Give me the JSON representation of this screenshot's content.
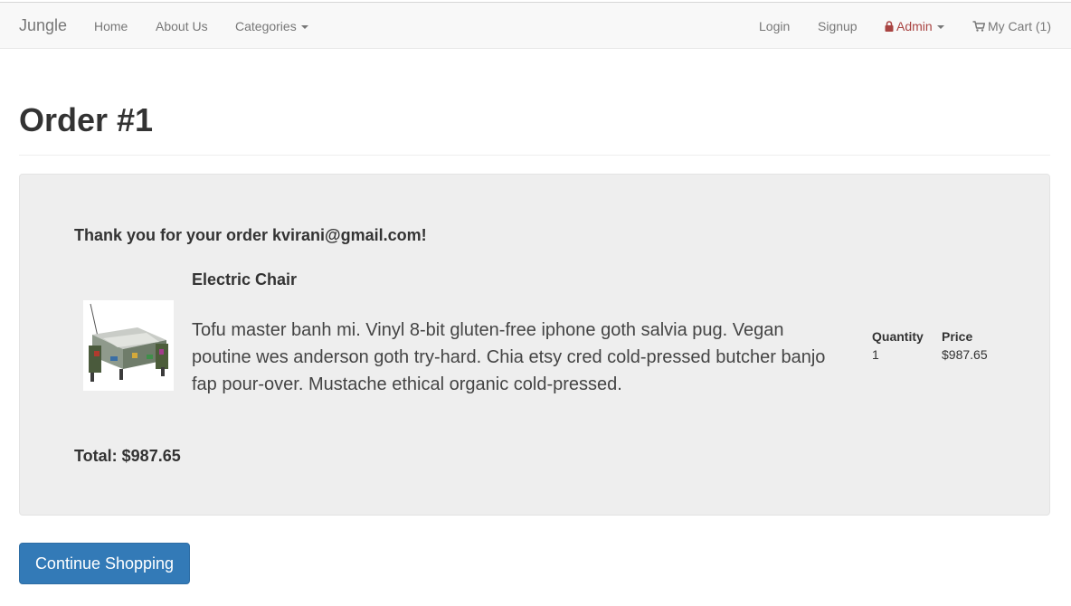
{
  "navbar": {
    "brand": "Jungle",
    "left_links": [
      "Home",
      "About Us",
      "Categories"
    ],
    "right_links": {
      "login": "Login",
      "signup": "Signup",
      "admin": "Admin",
      "cart": "My Cart (1)"
    },
    "admin_color": "#a94442"
  },
  "page": {
    "title": "Order #1"
  },
  "order": {
    "thank_you": "Thank you for your order kvirani@gmail.com!",
    "item": {
      "name": "Electric Chair",
      "description": "Tofu master banh mi. Vinyl 8-bit gluten-free iphone goth salvia pug. Vegan poutine wes anderson goth try-hard. Chia etsy cred cold-pressed butcher banjo fap pour-over. Mustache ethical organic cold-pressed.",
      "quantity_label": "Quantity",
      "quantity": "1",
      "price_label": "Price",
      "price": "$987.65"
    },
    "total": "Total: $987.65"
  },
  "actions": {
    "continue": "Continue Shopping",
    "accent": "#337ab7"
  }
}
